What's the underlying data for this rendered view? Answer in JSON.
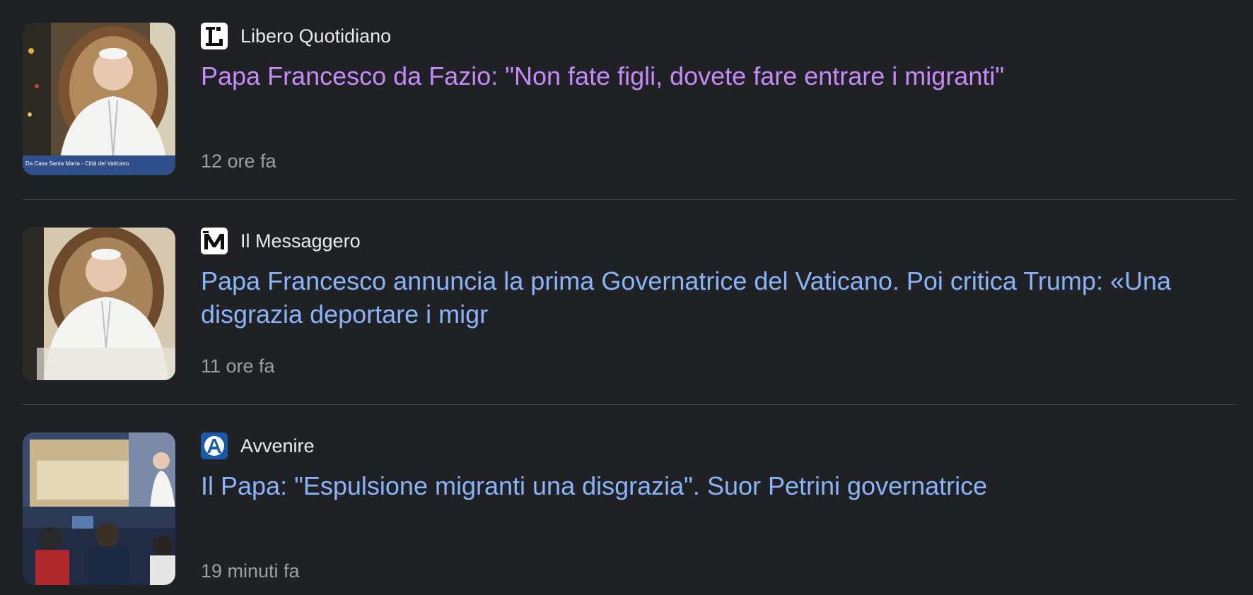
{
  "articles": [
    {
      "source": "Libero Quotidiano",
      "source_icon": "libero-logo-icon",
      "headline": "Papa Francesco da Fazio: \"Non fate figli, dovete fare entrare i migranti\"",
      "time": "12 ore fa",
      "visited": true,
      "thumbnail_caption": "Da Casa Santa Marta - Città del Vaticano"
    },
    {
      "source": "Il Messaggero",
      "source_icon": "messaggero-logo-icon",
      "headline": "Papa Francesco annuncia la prima Governatrice del Vaticano. Poi critica Trump: «Una disgrazia deportare i migr",
      "time": "11 ore fa",
      "visited": false
    },
    {
      "source": "Avvenire",
      "source_icon": "avvenire-logo-icon",
      "headline": "Il Papa: \"Espulsione migranti una disgrazia\". Suor Petrini governatrice",
      "time": "19 minuti fa",
      "visited": false
    }
  ],
  "colors": {
    "background": "#202124",
    "link": "#8ab4f8",
    "visited_link": "#c58af9",
    "source_text": "#e8eaed",
    "meta_text": "#9aa0a6",
    "divider": "#3c4043"
  }
}
